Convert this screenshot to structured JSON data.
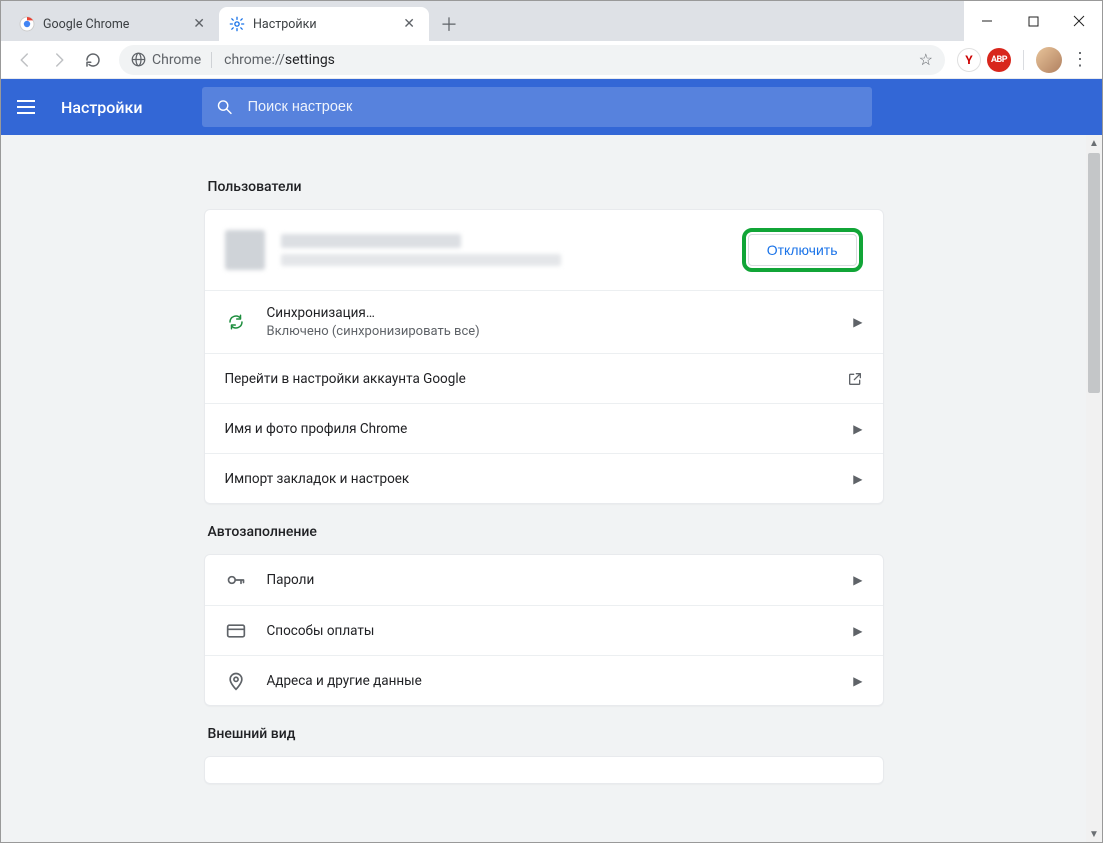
{
  "window": {
    "tabs": [
      {
        "title": "Google Chrome",
        "active": false
      },
      {
        "title": "Настройки",
        "active": true
      }
    ]
  },
  "omnibox": {
    "scheme_label": "Chrome",
    "url_host": "chrome://",
    "url_path": "settings"
  },
  "settings_bar": {
    "title": "Настройки",
    "search_placeholder": "Поиск настроек"
  },
  "sections": {
    "users": {
      "title": "Пользователи",
      "disconnect_btn": "Отключить",
      "sync_title": "Синхронизация…",
      "sync_sub": "Включено (синхронизировать все)",
      "google_account": "Перейти в настройки аккаунта Google",
      "profile_name_photo": "Имя и фото профиля Chrome",
      "import": "Импорт закладок и настроек"
    },
    "autofill": {
      "title": "Автозаполнение",
      "passwords": "Пароли",
      "payments": "Способы оплаты",
      "addresses": "Адреса и другие данные"
    },
    "appearance": {
      "title": "Внешний вид"
    }
  }
}
